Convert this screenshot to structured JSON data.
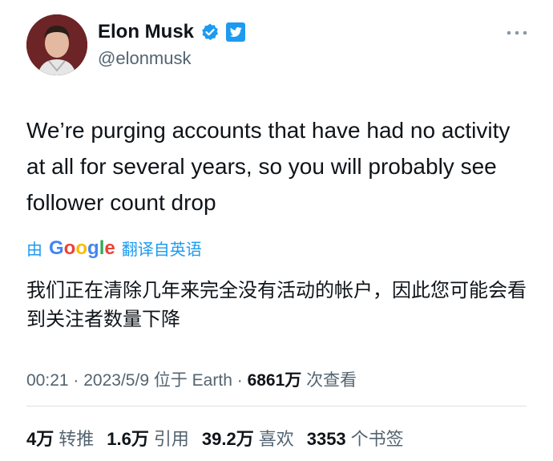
{
  "author": {
    "name": "Elon Musk",
    "handle": "@elonmusk",
    "avatar": "avatar-photo",
    "verified_icon": "verified-badge-icon",
    "badge_icon": "twitter-bird-icon"
  },
  "more_icon": "more-options-icon",
  "tweet": {
    "text": "We’re purging accounts that have had no activity at all for several years, so you will probably see follower count drop",
    "translate_prefix": "由",
    "translate_provider": "Google",
    "translate_suffix": "翻译自英语",
    "translated_text": "我们正在清除几年来完全没有活动的帐户，因此您可能会看到关注者数量下降"
  },
  "meta": {
    "time": "00:21",
    "sep1": "·",
    "date": "2023/5/9",
    "location": "位于 Earth",
    "sep2": "·",
    "views_count": "6861万",
    "views_label": "次查看"
  },
  "stats": [
    {
      "count": "4万",
      "label": "转推"
    },
    {
      "count": "1.6万",
      "label": "引用"
    },
    {
      "count": "39.2万",
      "label": "喜欢"
    },
    {
      "count": "3353",
      "label": "个书签"
    }
  ],
  "colors": {
    "accent": "#1d9bf0",
    "text": "#0f1419",
    "muted": "#536471"
  }
}
